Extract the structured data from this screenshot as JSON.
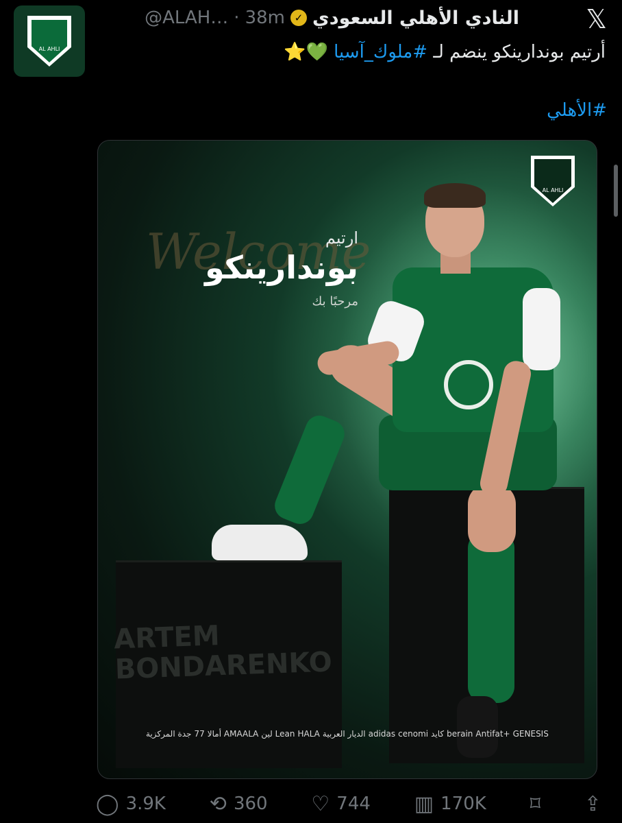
{
  "account": {
    "display_name": "النادي الأهلي السعودي",
    "handle": "@ALAH…",
    "separator": "·",
    "time": "38m",
    "verified_mark": "✓",
    "avatar_text": "AL AHLI",
    "x_logo": "𝕏"
  },
  "tweet": {
    "text_prefix": "أرتيم بوندارينكو ينضم لـ",
    "hashtag_1": "#ملوك_آسيا",
    "emoji": "💚⭐",
    "hashtag_2": "#الأهلي"
  },
  "media": {
    "first_name_ar": "ارتيم",
    "last_name_ar": "بوندارينكو",
    "welcome_ar": "مرحبًا بك",
    "script_word": "Welcome",
    "cube_text_line1": "ARTEM",
    "cube_text_line2": "BONDARENKO",
    "logo_text": "AL AHLI",
    "sponsors": [
      "جدة المركزية",
      "77",
      "أمالا AMAALA",
      "لين Lean",
      "HALA",
      "الديار العربية",
      "adidas",
      "cenomi",
      "كايد",
      "berain",
      "Antifat+",
      "GENESIS"
    ]
  },
  "actions": {
    "reply_count": "3.9K",
    "retweet_count": "360",
    "like_count": "744",
    "view_count": "170K"
  },
  "icons": {
    "reply": "reply-icon",
    "retweet": "retweet-icon",
    "like": "like-icon",
    "views": "views-icon",
    "bookmark": "bookmark-icon",
    "share": "share-icon"
  }
}
